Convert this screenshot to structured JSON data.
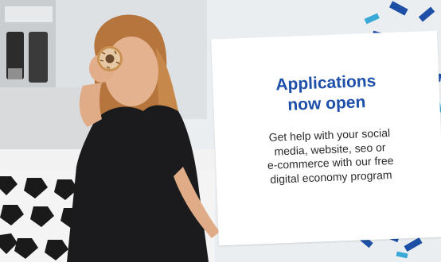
{
  "promo": {
    "headline": [
      "Applications",
      "now open"
    ],
    "body_lines": [
      "Get help with your social",
      "media, website, seo or",
      "e-commerce with our free",
      "digital economy program"
    ]
  },
  "colors": {
    "headline": "#1e4fa8",
    "confetti_primary": "#1d4fa6",
    "confetti_secondary": "#3aa9d8",
    "card": "#ffffff"
  },
  "photo": {
    "subject": "woman holding a donut over one eye",
    "icons": [
      "donut-icon"
    ]
  }
}
